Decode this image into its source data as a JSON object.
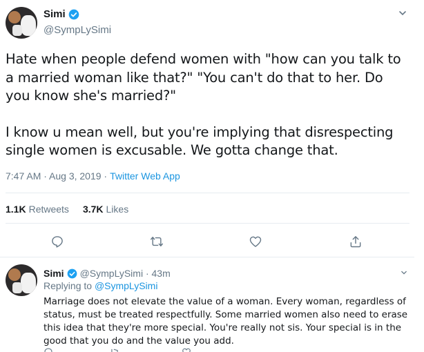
{
  "main_tweet": {
    "display_name": "Simi",
    "handle": "@SympLySimi",
    "paragraphs": [
      "Hate when people defend women with \"how can you talk to a married woman like that?\" \"You can't do that to her. Do you know she's married?\"",
      "I know u mean well, but you're implying that disrespecting single women is excusable. We gotta change that."
    ],
    "time": "7:47 AM · Aug 3, 2019 ·",
    "app": "Twitter Web App",
    "retweets_count": "1.1K",
    "retweets_label": "Retweets",
    "likes_count": "3.7K",
    "likes_label": "Likes",
    "icons": [
      "reply-icon",
      "retweet-icon",
      "like-icon",
      "share-icon"
    ]
  },
  "reply": {
    "display_name": "Simi",
    "handle_time": "@SympLySimi · 43m",
    "replying_prefix": "Replying to",
    "replying_to": "@SympLySimi",
    "text": "Marriage does not elevate the value of a woman. Every woman, regardless of status, must be treated respectfully. Some married women also need to erase this idea that they're more special. You're really not sis. Your special is in the good that you do and the value you add."
  },
  "colors": {
    "text": "#14171a",
    "secondary": "#657786",
    "link": "#1b95e0",
    "verified": "#1da1f2",
    "divider": "#e6ecf0"
  }
}
